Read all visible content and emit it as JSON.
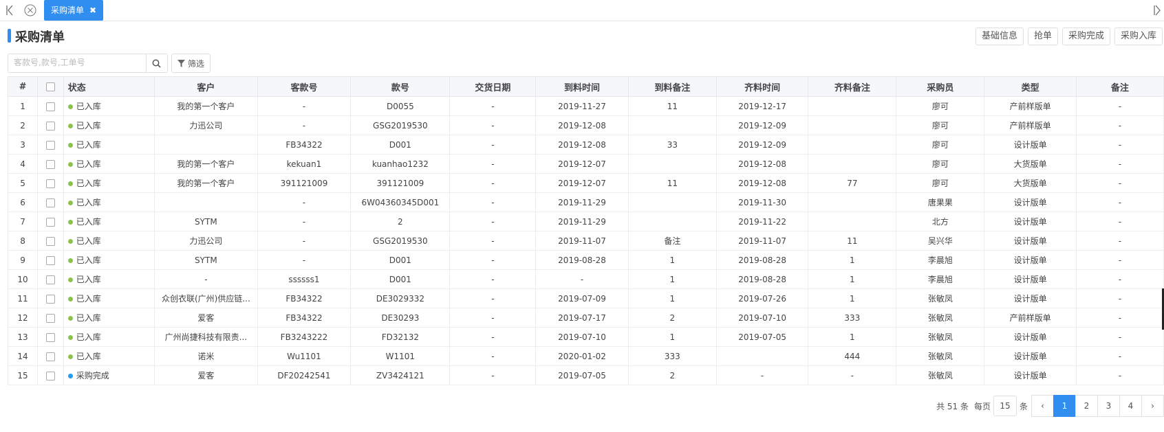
{
  "tabs": {
    "active_label": "采购清单",
    "close_glyph": "✖"
  },
  "page": {
    "title": "采购清单"
  },
  "actions": [
    "基础信息",
    "抢单",
    "采购完成",
    "采购入库"
  ],
  "search": {
    "placeholder": "客款号,款号,工单号",
    "value": ""
  },
  "filter_label": "筛选",
  "colors": {
    "accent": "#2f8ef0",
    "status_received": "#8bc34a",
    "status_complete": "#1e9ff2"
  },
  "table": {
    "headers": [
      "#",
      "",
      "状态",
      "客户",
      "客款号",
      "款号",
      "交货日期",
      "到料时间",
      "到料备注",
      "齐料时间",
      "齐料备注",
      "采购员",
      "类型",
      "备注"
    ],
    "rows": [
      {
        "no": "1",
        "status": "已入库",
        "status_color": "#8bc34a",
        "customer": "我的第一个客户",
        "cust_style": "-",
        "style": "D0055",
        "delivery": "-",
        "arrive": "2019-11-27",
        "arrive_note": "11",
        "complete": "2019-12-17",
        "complete_note": "",
        "buyer": "廖可",
        "type": "产前样版单",
        "note": "-"
      },
      {
        "no": "2",
        "status": "已入库",
        "status_color": "#8bc34a",
        "customer": "力迅公司",
        "cust_style": "-",
        "style": "GSG2019530",
        "delivery": "-",
        "arrive": "2019-12-08",
        "arrive_note": "",
        "complete": "2019-12-09",
        "complete_note": "",
        "buyer": "廖可",
        "type": "产前样版单",
        "note": "-"
      },
      {
        "no": "3",
        "status": "已入库",
        "status_color": "#8bc34a",
        "customer": "",
        "cust_style": "FB34322",
        "style": "D001",
        "delivery": "-",
        "arrive": "2019-12-08",
        "arrive_note": "33",
        "complete": "2019-12-09",
        "complete_note": "",
        "buyer": "廖可",
        "type": "设计版单",
        "note": "-"
      },
      {
        "no": "4",
        "status": "已入库",
        "status_color": "#8bc34a",
        "customer": "我的第一个客户",
        "cust_style": "kekuan1",
        "style": "kuanhao1232",
        "delivery": "-",
        "arrive": "2019-12-07",
        "arrive_note": "",
        "complete": "2019-12-08",
        "complete_note": "",
        "buyer": "廖可",
        "type": "大货版单",
        "note": "-"
      },
      {
        "no": "5",
        "status": "已入库",
        "status_color": "#8bc34a",
        "customer": "我的第一个客户",
        "cust_style": "391121009",
        "style": "391121009",
        "delivery": "-",
        "arrive": "2019-12-07",
        "arrive_note": "11",
        "complete": "2019-12-08",
        "complete_note": "77",
        "buyer": "廖可",
        "type": "大货版单",
        "note": "-"
      },
      {
        "no": "6",
        "status": "已入库",
        "status_color": "#8bc34a",
        "customer": "",
        "cust_style": "-",
        "style": "6W04360345D001",
        "delivery": "-",
        "arrive": "2019-11-29",
        "arrive_note": "",
        "complete": "2019-11-30",
        "complete_note": "",
        "buyer": "唐果果",
        "type": "设计版单",
        "note": "-"
      },
      {
        "no": "7",
        "status": "已入库",
        "status_color": "#8bc34a",
        "customer": "SYTM",
        "cust_style": "-",
        "style": "2",
        "delivery": "-",
        "arrive": "2019-11-29",
        "arrive_note": "",
        "complete": "2019-11-22",
        "complete_note": "",
        "buyer": "北方",
        "type": "设计版单",
        "note": "-"
      },
      {
        "no": "8",
        "status": "已入库",
        "status_color": "#8bc34a",
        "customer": "力迅公司",
        "cust_style": "-",
        "style": "GSG2019530",
        "delivery": "-",
        "arrive": "2019-11-07",
        "arrive_note": "备注",
        "complete": "2019-11-07",
        "complete_note": "11",
        "buyer": "吴兴华",
        "type": "设计版单",
        "note": "-"
      },
      {
        "no": "9",
        "status": "已入库",
        "status_color": "#8bc34a",
        "customer": "SYTM",
        "cust_style": "-",
        "style": "D001",
        "delivery": "-",
        "arrive": "2019-08-28",
        "arrive_note": "1",
        "complete": "2019-08-28",
        "complete_note": "1",
        "buyer": "李晨旭",
        "type": "设计版单",
        "note": "-"
      },
      {
        "no": "10",
        "status": "已入库",
        "status_color": "#8bc34a",
        "customer": "-",
        "cust_style": "ssssss1",
        "style": "D001",
        "delivery": "-",
        "arrive": "-",
        "arrive_note": "1",
        "complete": "2019-08-28",
        "complete_note": "1",
        "buyer": "李晨旭",
        "type": "设计版单",
        "note": "-"
      },
      {
        "no": "11",
        "status": "已入库",
        "status_color": "#8bc34a",
        "customer": "众创衣联(广州)供应链...",
        "cust_style": "FB34322",
        "style": "DE3029332",
        "delivery": "-",
        "arrive": "2019-07-09",
        "arrive_note": "1",
        "complete": "2019-07-26",
        "complete_note": "1",
        "buyer": "张敏凤",
        "type": "设计版单",
        "note": "-"
      },
      {
        "no": "12",
        "status": "已入库",
        "status_color": "#8bc34a",
        "customer": "爱客",
        "cust_style": "FB34322",
        "style": "DE30293",
        "delivery": "-",
        "arrive": "2019-07-17",
        "arrive_note": "2",
        "complete": "2019-07-10",
        "complete_note": "333",
        "buyer": "张敏凤",
        "type": "产前样版单",
        "note": "-"
      },
      {
        "no": "13",
        "status": "已入库",
        "status_color": "#8bc34a",
        "customer": "广州尚捷科技有限责...",
        "cust_style": "FB3243222",
        "style": "FD32132",
        "delivery": "-",
        "arrive": "2019-07-10",
        "arrive_note": "1",
        "complete": "2019-07-05",
        "complete_note": "1",
        "buyer": "张敏凤",
        "type": "设计版单",
        "note": "-"
      },
      {
        "no": "14",
        "status": "已入库",
        "status_color": "#8bc34a",
        "customer": "诺米",
        "cust_style": "Wu1101",
        "style": "W1101",
        "delivery": "-",
        "arrive": "2020-01-02",
        "arrive_note": "333",
        "complete": "",
        "complete_note": "444",
        "buyer": "张敏凤",
        "type": "设计版单",
        "note": "-"
      },
      {
        "no": "15",
        "status": "采购完成",
        "status_color": "#1e9ff2",
        "customer": "爱客",
        "cust_style": "DF20242541",
        "style": "ZV3424121",
        "delivery": "-",
        "arrive": "2019-07-05",
        "arrive_note": "2",
        "complete": "-",
        "complete_note": "-",
        "buyer": "张敏凤",
        "type": "设计版单",
        "note": "-"
      }
    ]
  },
  "pagination": {
    "total_text": "共 51 条",
    "per_page_label": "每页",
    "per_page": "15",
    "unit": "条",
    "prev": "‹",
    "next": "›",
    "pages": [
      "1",
      "2",
      "3",
      "4"
    ],
    "current": "1"
  }
}
